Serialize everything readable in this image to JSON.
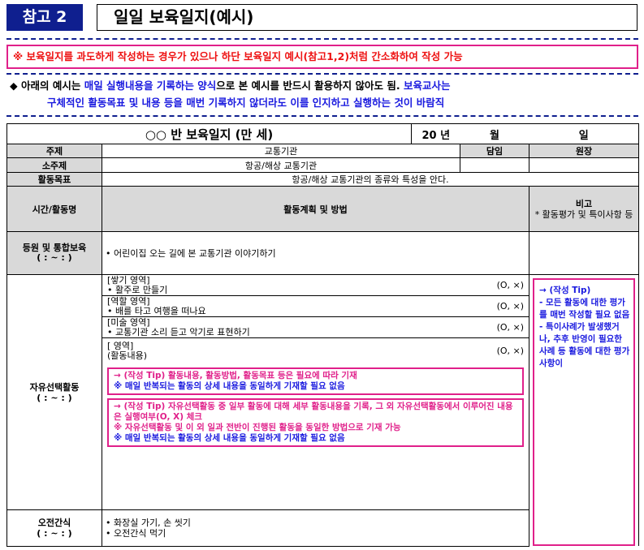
{
  "header": {
    "tag": "참고 2",
    "title": "일일 보육일지(예시)"
  },
  "notice": "※ 보육일지를 과도하게 작성하는 경우가 있으나 하단 보육일지 예시(참고1,2)처럼 간소화하여 작성 가능",
  "intro": {
    "bullet": "◆",
    "l1_a": "아래의 예시는 ",
    "l1_b": "매일 실행내용을 기록하는 양식",
    "l1_c": "으로 본 예시를 반드시 활용하지 않아도 됨.",
    "l1_d": " 보육교사는",
    "l2": "구체적인 활동목표 및 내용 등을 매번 기록하지 않더라도 이를 인지하고 실행하는 것이 바람직"
  },
  "table": {
    "class_title": "○○ 반 보육일지 (만 세)",
    "year": "20 년",
    "month": "월",
    "day": "일",
    "theme_label": "주제",
    "theme_value": "교통기관",
    "teacher_label": "담임",
    "director_label": "원장",
    "subtheme_label": "소주제",
    "subtheme_value": "항공/해상 교통기관",
    "goal_label": "활동목표",
    "goal_value": "항공/해상 교통기관의 종류와 특성을 안다.",
    "time_label": "시간/활동명",
    "plan_label": "활동계획 및 방법",
    "note_label": "비고",
    "note_sub": "* 활동평가 및 특이사항 등",
    "arrival_label": "등원 및 통합보육",
    "arrival_time": "( : ~ : )",
    "arrival_text": "• 어린이집 오는 길에 본 교통기관 이야기하기",
    "free_label": "자유선택활동",
    "free_time": "( : ~ : )",
    "areas": [
      {
        "area": "[쌓기 영역]",
        "activity": "• 활주로 만들기",
        "check": "(O, ×)"
      },
      {
        "area": "[역할 영역]",
        "activity": "• 배를 타고 여행을 떠나요",
        "check": "(O, ×)"
      },
      {
        "area": "[미술 영역]",
        "activity": "• 교통기관 소리 듣고 악기로 표현하기",
        "check": "(O, ×)"
      },
      {
        "area": "[ 영역]",
        "activity": "(활동내용)",
        "check": "(O, ×)"
      }
    ],
    "tip1_a": "→ (작성 Tip) 활동내용, 활동방법, 활동목표 등은 필요에 따라 기재",
    "tip1_b": "※ 매일 반복되는 활동의 상세 내용을 동일하게 기재할 필요 없음",
    "tip2_a": "→ (작성 Tip) 자유선택활동 중 일부 활동에 대해 세부 활동내용을 기록, 그 외 자유선택활동에서 이루어진 내용은 실행여부(O, X) 체크",
    "tip2_b": "※ 자유선택활동 및 이 외 일과 전반이 진행된 활동을 동일한 방법으로 기재 가능",
    "tip2_c": "※ 매일 반복되는 활동의 상세 내용을 동일하게 기재할 필요 없음",
    "side_tip": "→ (작성 Tip)\n- 모든 활동에 대한 평가를 매번 작성할 필요 없음\n- 특이사례가 발생했거나, 추후 반영이 필요한 사례 등 활동에 대한 평가사항이",
    "snack_label": "오전간식",
    "snack_time": "( : ~ : )",
    "snack_1": "• 화장실 가기, 손 씻기",
    "snack_2": "• 오전간식 먹기"
  }
}
